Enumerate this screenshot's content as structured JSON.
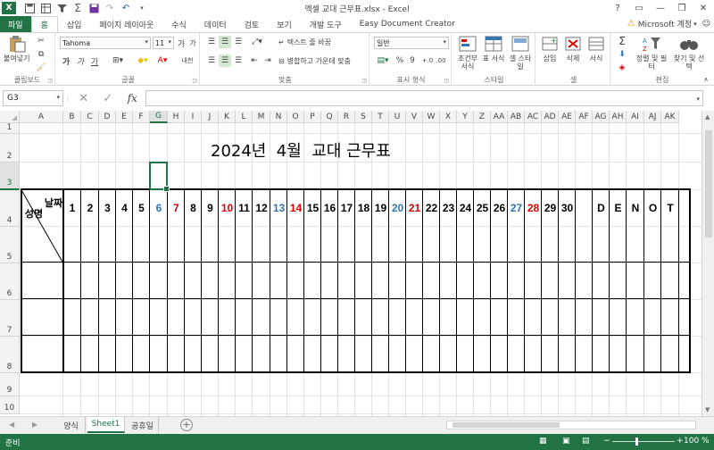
{
  "window": {
    "title": "엑셀 교대 근무표.xlsx - Excel",
    "logo": "X"
  },
  "qat": {
    "icons": [
      "save-icon",
      "filter-icon",
      "sum-icon",
      "save-disk-icon",
      "redo-icon",
      "undo-icon"
    ]
  },
  "ribbon_tabs": [
    "파일",
    "홈",
    "삽입",
    "페이지 레이아웃",
    "수식",
    "데이터",
    "검토",
    "보기",
    "개발 도구",
    "Easy Document Creator"
  ],
  "account": {
    "label": "Microsoft 계정"
  },
  "ribbon": {
    "clipboard": {
      "paste_label": "붙여넣기",
      "group_label": "클립보드"
    },
    "font": {
      "font_name": "Tahoma",
      "font_size": "11",
      "group_label": "글꼴",
      "bold": "가",
      "italic": "가",
      "underline": "가",
      "grow": "가",
      "shrink": "가",
      "phonetic": "내천"
    },
    "alignment": {
      "wrap_label": "텍스트 줄 바꿈",
      "merge_label": "병합하고 가운데 맞춤",
      "group_label": "맞춤"
    },
    "number": {
      "format": "일반",
      "percent": "%",
      "comma": "9",
      "group_label": "표시 형식"
    },
    "styles": {
      "conditional_label": "조건부 서식",
      "table_label": "표 서식",
      "cell_style_label": "셀 스타일",
      "group_label": "스타일"
    },
    "cells": {
      "insert_label": "삽입",
      "delete_label": "삭제",
      "format_label": "서식",
      "group_label": "셀"
    },
    "editing": {
      "sort_label": "정렬 및 필터",
      "find_label": "찾기 및 선택",
      "group_label": "편집"
    }
  },
  "formula_bar": {
    "name_box": "G3",
    "fx": "fx",
    "value": ""
  },
  "columns": [
    "A",
    "B",
    "C",
    "D",
    "E",
    "F",
    "G",
    "H",
    "I",
    "J",
    "K",
    "L",
    "M",
    "N",
    "O",
    "P",
    "Q",
    "R",
    "S",
    "T",
    "U",
    "V",
    "W",
    "X",
    "Y",
    "Z",
    "AA",
    "AB",
    "AC",
    "AD",
    "AE",
    "AF",
    "AG",
    "AH",
    "AI",
    "AJ",
    "AK"
  ],
  "rows": [
    "1",
    "2",
    "3",
    "4",
    "5",
    "6",
    "7",
    "8",
    "9",
    "10"
  ],
  "selected_cell": "G3",
  "sheet": {
    "title": "2024년  4월  교대 근무표",
    "corner_top": "날짜",
    "corner_bottom": "성명",
    "days": [
      {
        "label": "1",
        "color": "#000000"
      },
      {
        "label": "2",
        "color": "#000000"
      },
      {
        "label": "3",
        "color": "#000000"
      },
      {
        "label": "4",
        "color": "#000000"
      },
      {
        "label": "5",
        "color": "#000000"
      },
      {
        "label": "6",
        "color": "#2e75b6"
      },
      {
        "label": "7",
        "color": "#e00000"
      },
      {
        "label": "8",
        "color": "#000000"
      },
      {
        "label": "9",
        "color": "#000000"
      },
      {
        "label": "10",
        "color": "#e00000"
      },
      {
        "label": "11",
        "color": "#000000"
      },
      {
        "label": "12",
        "color": "#000000"
      },
      {
        "label": "13",
        "color": "#2e75b6"
      },
      {
        "label": "14",
        "color": "#e00000"
      },
      {
        "label": "15",
        "color": "#000000"
      },
      {
        "label": "16",
        "color": "#000000"
      },
      {
        "label": "17",
        "color": "#000000"
      },
      {
        "label": "18",
        "color": "#000000"
      },
      {
        "label": "19",
        "color": "#000000"
      },
      {
        "label": "20",
        "color": "#2e75b6"
      },
      {
        "label": "21",
        "color": "#e00000"
      },
      {
        "label": "22",
        "color": "#000000"
      },
      {
        "label": "23",
        "color": "#000000"
      },
      {
        "label": "24",
        "color": "#000000"
      },
      {
        "label": "25",
        "color": "#000000"
      },
      {
        "label": "26",
        "color": "#000000"
      },
      {
        "label": "27",
        "color": "#2e75b6"
      },
      {
        "label": "28",
        "color": "#e00000"
      },
      {
        "label": "29",
        "color": "#000000"
      },
      {
        "label": "30",
        "color": "#000000"
      }
    ],
    "shift_codes": [
      "D",
      "E",
      "N",
      "O",
      "T"
    ]
  },
  "sheet_tabs": [
    {
      "name": "양식",
      "active": false
    },
    {
      "name": "Sheet1",
      "active": true
    },
    {
      "name": "공휴일",
      "active": false
    }
  ],
  "status": {
    "text": "준비",
    "zoom": "100 %"
  },
  "colors": {
    "accent": "#217346",
    "saturday": "#2e75b6",
    "holiday": "#e00000"
  }
}
